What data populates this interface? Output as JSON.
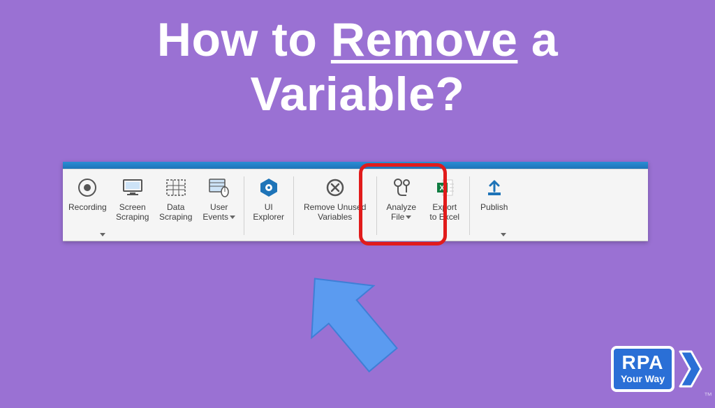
{
  "title": {
    "prefix": "How to ",
    "underlined": "Remove",
    "suffix": " a\nVariable?"
  },
  "ribbon": {
    "items": [
      {
        "label": "Recording",
        "icon": "record-icon",
        "dropdown": true
      },
      {
        "label": "Screen\nScraping",
        "icon": "screen-scraping-icon",
        "dropdown": false
      },
      {
        "label": "Data\nScraping",
        "icon": "data-scraping-icon",
        "dropdown": false
      },
      {
        "label": "User\nEvents",
        "icon": "user-events-icon",
        "dropdown": true
      }
    ],
    "items2": [
      {
        "label": "UI\nExplorer",
        "icon": "ui-explorer-icon",
        "dropdown": false
      }
    ],
    "items3": [
      {
        "label": "Remove Unused\nVariables",
        "icon": "remove-unused-icon",
        "dropdown": false
      }
    ],
    "items4": [
      {
        "label": "Analyze\nFile",
        "icon": "analyze-file-icon",
        "dropdown": true
      },
      {
        "label": "Export\nto Excel",
        "icon": "export-excel-icon",
        "dropdown": false
      }
    ],
    "items5": [
      {
        "label": "Publish",
        "icon": "publish-icon",
        "dropdown": true
      }
    ]
  },
  "logo": {
    "line1": "RPA",
    "line2": "Your Way",
    "tm": "™"
  },
  "colors": {
    "background": "#9a71d3",
    "highlight": "#e11b1b",
    "arrow": "#5b9bf0",
    "brandBlue": "#2a6fd6",
    "ribbonBlue": "#1e74b8"
  }
}
